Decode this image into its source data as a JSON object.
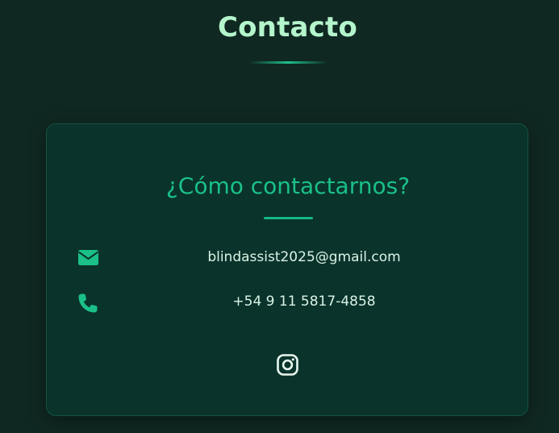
{
  "section": {
    "title": "Contacto"
  },
  "card": {
    "title": "¿Cómo contactarnos?",
    "contacts": [
      {
        "icon": "envelope-icon",
        "text": "blindassist2025@gmail.com"
      },
      {
        "icon": "phone-icon",
        "text": "+54 9 11 5817-4858"
      }
    ],
    "social": [
      {
        "icon": "instagram-icon"
      }
    ]
  },
  "colors": {
    "background": "#102822",
    "card_background": "#0a332b",
    "heading": "#b4f5cc",
    "accent": "#1ac088",
    "text": "#d9f3e6"
  }
}
